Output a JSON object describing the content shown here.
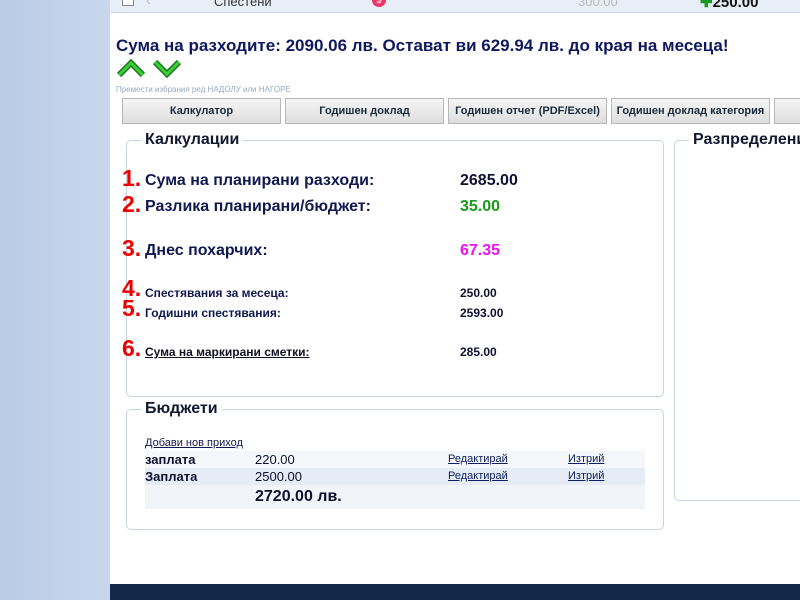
{
  "top_row": {
    "label": "Спестени",
    "amount_faded": "300.00",
    "amount": "250.00"
  },
  "summary": "Сума на разходите: 2090.06 лв. Остават ви 629.94 лв. до края на месеца!",
  "move_hint": "Премести избрания ред НАДОЛУ или НАГОРЕ",
  "tabs": [
    "Калкулатор",
    "Годишен доклад",
    "Годишен отчет (PDF/Excel)",
    "Годишен доклад категория"
  ],
  "calculations": {
    "title": "Калкулации",
    "rows": [
      {
        "num": "1.",
        "label": "Сума на планирани разходи:",
        "value": "2685.00",
        "color": "#101030"
      },
      {
        "num": "2.",
        "label": "Разлика планирани/бюджет:",
        "value": "35.00",
        "color": "#1a9a1a"
      },
      {
        "num": "3.",
        "label": "Днес похарчих:",
        "value": "67.35",
        "color": "#ee11ee"
      },
      {
        "num": "4.",
        "label": "Спестявания за месеца:",
        "value": "250.00",
        "color": "#101030"
      },
      {
        "num": "5.",
        "label": "Годишни спестявания:",
        "value": "2593.00",
        "color": "#101030"
      },
      {
        "num": "6.",
        "label": "Сума на маркирани сметки:",
        "value": "285.00",
        "color": "#101030"
      }
    ]
  },
  "distribution": {
    "title": "Разпределение"
  },
  "budgets": {
    "title": "Бюджети",
    "add_link": "Добави нов приход",
    "rows": [
      {
        "name": "заплата",
        "amount": "220.00",
        "edit": "Редактирай",
        "delete": "Изтрий"
      },
      {
        "name": "Заплата",
        "amount": "2500.00",
        "edit": "Редактирай",
        "delete": "Изтрий"
      }
    ],
    "total": "2720.00 лв."
  }
}
